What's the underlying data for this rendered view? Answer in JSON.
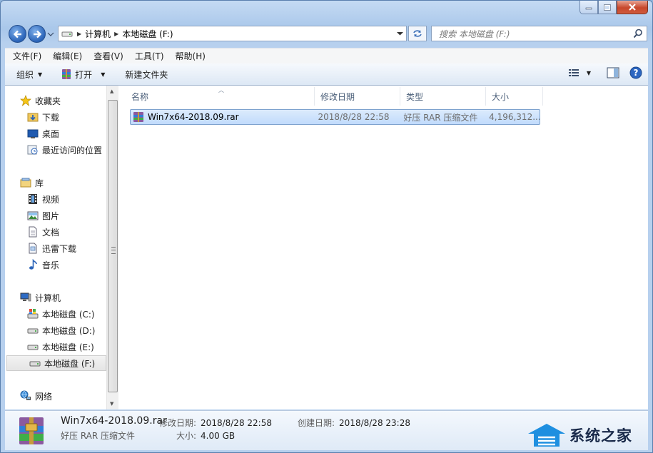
{
  "window": {
    "colors": {
      "accent": "#3c7fd6",
      "selection": "#c1dbfc",
      "close": "#c7472c"
    }
  },
  "address": {
    "crumbs": [
      "计算机",
      "本地磁盘 (F:)"
    ]
  },
  "search": {
    "placeholder": "搜索 本地磁盘 (F:)"
  },
  "menu": [
    "文件(F)",
    "编辑(E)",
    "查看(V)",
    "工具(T)",
    "帮助(H)"
  ],
  "toolbar": {
    "organize": "组织",
    "open": "打开",
    "new_folder": "新建文件夹"
  },
  "nav": {
    "favorites": "收藏夹",
    "downloads": "下载",
    "desktop": "桌面",
    "recent": "最近访问的位置",
    "libraries": "库",
    "videos": "视频",
    "pictures": "图片",
    "documents": "文档",
    "xunlei": "迅雷下载",
    "music": "音乐",
    "computer": "计算机",
    "drive_c": "本地磁盘 (C:)",
    "drive_d": "本地磁盘 (D:)",
    "drive_e": "本地磁盘 (E:)",
    "drive_f": "本地磁盘 (F:)",
    "network": "网络"
  },
  "columns": {
    "name": "名称",
    "modified": "修改日期",
    "type": "类型",
    "size": "大小"
  },
  "files": [
    {
      "name": "Win7x64-2018.09.rar",
      "modified": "2018/8/28 22:58",
      "type": "好压 RAR 压缩文件",
      "size": "4,196,312..."
    }
  ],
  "details": {
    "name": "Win7x64-2018.09.rar",
    "type": "好压 RAR 压缩文件",
    "modified_label": "修改日期:",
    "modified_value": "2018/8/28 22:58",
    "created_label": "创建日期:",
    "created_value": "2018/8/28 23:28",
    "size_label": "大小:",
    "size_value": "4.00 GB"
  },
  "watermark": {
    "text": "系统之家"
  }
}
